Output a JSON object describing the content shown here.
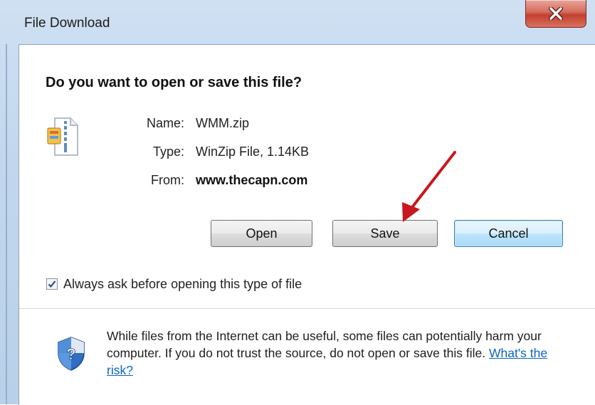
{
  "window": {
    "title": "File Download",
    "close_glyph": "close-icon"
  },
  "dialog": {
    "question": "Do you want to open or save this file?",
    "file": {
      "icon": "zip-file-icon",
      "name_label": "Name:",
      "name_value": "WMM.zip",
      "type_label": "Type:",
      "type_value": "WinZip File, 1.14KB",
      "from_label": "From:",
      "from_value": "www.thecapn.com"
    },
    "buttons": {
      "open": "Open",
      "save": "Save",
      "cancel": "Cancel"
    },
    "always_ask": {
      "label": "Always ask before opening this type of file",
      "checked": true
    },
    "warning": {
      "icon": "shield-question-icon",
      "text": "While files from the Internet can be useful, some files can potentially harm your computer. If you do not trust the source, do not open or save this file.",
      "link": "What's the risk?"
    }
  },
  "annotation": {
    "arrow_color": "#c8171d",
    "accent": "#0b66c3"
  }
}
